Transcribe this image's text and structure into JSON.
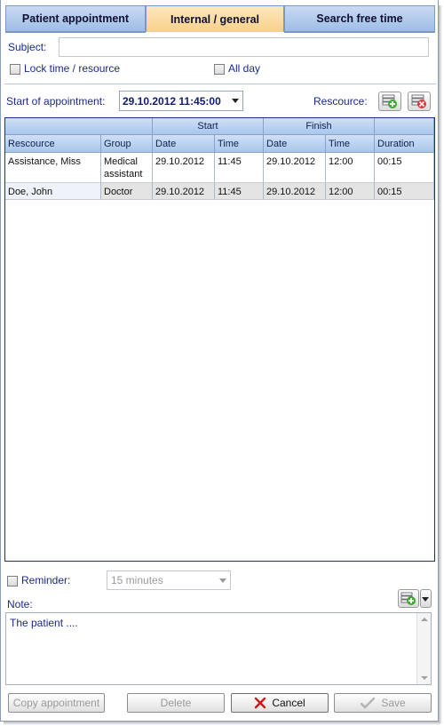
{
  "tabs": [
    {
      "label": "Patient appointment",
      "active": false
    },
    {
      "label": "Internal / general",
      "active": true
    },
    {
      "label": "Search free time",
      "active": false
    }
  ],
  "subject": {
    "label": "Subject:",
    "value": ""
  },
  "lock": {
    "label": "Lock time / resource",
    "checked": false
  },
  "all_day": {
    "label": "All day",
    "checked": false
  },
  "start": {
    "label": "Start of appointment:",
    "value": "29.10.2012 11:45:00"
  },
  "resource_label": "Rescource:",
  "grid": {
    "group_headers": {
      "start": "Start",
      "finish": "Finish"
    },
    "columns": [
      "Rescource",
      "Group",
      "Date",
      "Time",
      "Date",
      "Time",
      "Duration"
    ],
    "rows": [
      {
        "resource": "Assistance, Miss",
        "group": "Medical assistant",
        "start_date": "29.10.2012",
        "start_time": "11:45",
        "finish_date": "29.10.2012",
        "finish_time": "12:00",
        "duration": "00:15"
      },
      {
        "resource": "Doe, John",
        "group": "Doctor",
        "start_date": "29.10.2012",
        "start_time": "11:45",
        "finish_date": "29.10.2012",
        "finish_time": "12:00",
        "duration": "00:15"
      }
    ]
  },
  "reminder": {
    "label": "Reminder:",
    "value": "15 minutes",
    "checked": false
  },
  "note": {
    "label": "Note:",
    "value": "The patient ...."
  },
  "buttons": {
    "copy": "Copy appointment",
    "delete": "Delete",
    "cancel": "Cancel",
    "save": "Save"
  },
  "colors": {
    "tab_active": "#f9d08a",
    "tab": "#a9c6ec",
    "grid_border": "#1d2c8a",
    "label": "#1a2a8c"
  }
}
